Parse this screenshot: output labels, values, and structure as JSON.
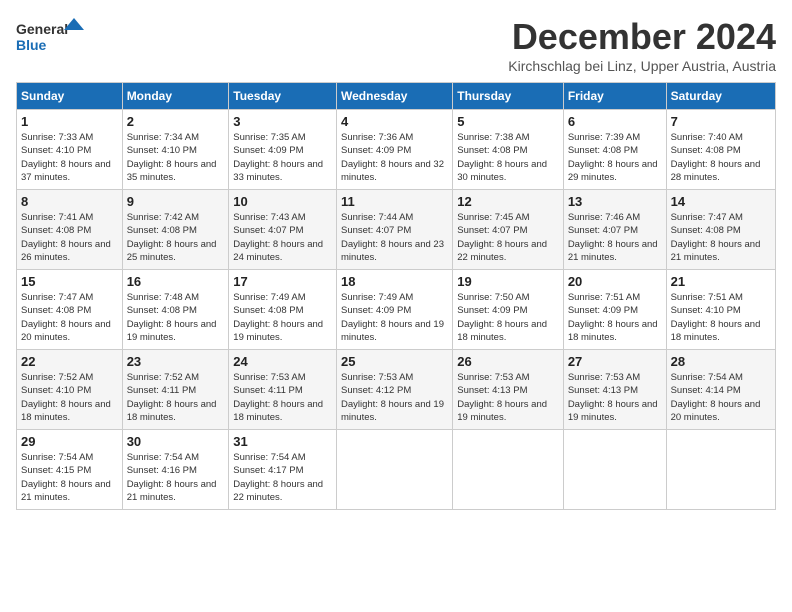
{
  "logo": {
    "line1": "General",
    "line2": "Blue"
  },
  "title": "December 2024",
  "subtitle": "Kirchschlag bei Linz, Upper Austria, Austria",
  "days_of_week": [
    "Sunday",
    "Monday",
    "Tuesday",
    "Wednesday",
    "Thursday",
    "Friday",
    "Saturday"
  ],
  "weeks": [
    [
      {
        "day": "1",
        "sunrise": "Sunrise: 7:33 AM",
        "sunset": "Sunset: 4:10 PM",
        "daylight": "Daylight: 8 hours and 37 minutes."
      },
      {
        "day": "2",
        "sunrise": "Sunrise: 7:34 AM",
        "sunset": "Sunset: 4:10 PM",
        "daylight": "Daylight: 8 hours and 35 minutes."
      },
      {
        "day": "3",
        "sunrise": "Sunrise: 7:35 AM",
        "sunset": "Sunset: 4:09 PM",
        "daylight": "Daylight: 8 hours and 33 minutes."
      },
      {
        "day": "4",
        "sunrise": "Sunrise: 7:36 AM",
        "sunset": "Sunset: 4:09 PM",
        "daylight": "Daylight: 8 hours and 32 minutes."
      },
      {
        "day": "5",
        "sunrise": "Sunrise: 7:38 AM",
        "sunset": "Sunset: 4:08 PM",
        "daylight": "Daylight: 8 hours and 30 minutes."
      },
      {
        "day": "6",
        "sunrise": "Sunrise: 7:39 AM",
        "sunset": "Sunset: 4:08 PM",
        "daylight": "Daylight: 8 hours and 29 minutes."
      },
      {
        "day": "7",
        "sunrise": "Sunrise: 7:40 AM",
        "sunset": "Sunset: 4:08 PM",
        "daylight": "Daylight: 8 hours and 28 minutes."
      }
    ],
    [
      {
        "day": "8",
        "sunrise": "Sunrise: 7:41 AM",
        "sunset": "Sunset: 4:08 PM",
        "daylight": "Daylight: 8 hours and 26 minutes."
      },
      {
        "day": "9",
        "sunrise": "Sunrise: 7:42 AM",
        "sunset": "Sunset: 4:08 PM",
        "daylight": "Daylight: 8 hours and 25 minutes."
      },
      {
        "day": "10",
        "sunrise": "Sunrise: 7:43 AM",
        "sunset": "Sunset: 4:07 PM",
        "daylight": "Daylight: 8 hours and 24 minutes."
      },
      {
        "day": "11",
        "sunrise": "Sunrise: 7:44 AM",
        "sunset": "Sunset: 4:07 PM",
        "daylight": "Daylight: 8 hours and 23 minutes."
      },
      {
        "day": "12",
        "sunrise": "Sunrise: 7:45 AM",
        "sunset": "Sunset: 4:07 PM",
        "daylight": "Daylight: 8 hours and 22 minutes."
      },
      {
        "day": "13",
        "sunrise": "Sunrise: 7:46 AM",
        "sunset": "Sunset: 4:07 PM",
        "daylight": "Daylight: 8 hours and 21 minutes."
      },
      {
        "day": "14",
        "sunrise": "Sunrise: 7:47 AM",
        "sunset": "Sunset: 4:08 PM",
        "daylight": "Daylight: 8 hours and 21 minutes."
      }
    ],
    [
      {
        "day": "15",
        "sunrise": "Sunrise: 7:47 AM",
        "sunset": "Sunset: 4:08 PM",
        "daylight": "Daylight: 8 hours and 20 minutes."
      },
      {
        "day": "16",
        "sunrise": "Sunrise: 7:48 AM",
        "sunset": "Sunset: 4:08 PM",
        "daylight": "Daylight: 8 hours and 19 minutes."
      },
      {
        "day": "17",
        "sunrise": "Sunrise: 7:49 AM",
        "sunset": "Sunset: 4:08 PM",
        "daylight": "Daylight: 8 hours and 19 minutes."
      },
      {
        "day": "18",
        "sunrise": "Sunrise: 7:49 AM",
        "sunset": "Sunset: 4:09 PM",
        "daylight": "Daylight: 8 hours and 19 minutes."
      },
      {
        "day": "19",
        "sunrise": "Sunrise: 7:50 AM",
        "sunset": "Sunset: 4:09 PM",
        "daylight": "Daylight: 8 hours and 18 minutes."
      },
      {
        "day": "20",
        "sunrise": "Sunrise: 7:51 AM",
        "sunset": "Sunset: 4:09 PM",
        "daylight": "Daylight: 8 hours and 18 minutes."
      },
      {
        "day": "21",
        "sunrise": "Sunrise: 7:51 AM",
        "sunset": "Sunset: 4:10 PM",
        "daylight": "Daylight: 8 hours and 18 minutes."
      }
    ],
    [
      {
        "day": "22",
        "sunrise": "Sunrise: 7:52 AM",
        "sunset": "Sunset: 4:10 PM",
        "daylight": "Daylight: 8 hours and 18 minutes."
      },
      {
        "day": "23",
        "sunrise": "Sunrise: 7:52 AM",
        "sunset": "Sunset: 4:11 PM",
        "daylight": "Daylight: 8 hours and 18 minutes."
      },
      {
        "day": "24",
        "sunrise": "Sunrise: 7:53 AM",
        "sunset": "Sunset: 4:11 PM",
        "daylight": "Daylight: 8 hours and 18 minutes."
      },
      {
        "day": "25",
        "sunrise": "Sunrise: 7:53 AM",
        "sunset": "Sunset: 4:12 PM",
        "daylight": "Daylight: 8 hours and 19 minutes."
      },
      {
        "day": "26",
        "sunrise": "Sunrise: 7:53 AM",
        "sunset": "Sunset: 4:13 PM",
        "daylight": "Daylight: 8 hours and 19 minutes."
      },
      {
        "day": "27",
        "sunrise": "Sunrise: 7:53 AM",
        "sunset": "Sunset: 4:13 PM",
        "daylight": "Daylight: 8 hours and 19 minutes."
      },
      {
        "day": "28",
        "sunrise": "Sunrise: 7:54 AM",
        "sunset": "Sunset: 4:14 PM",
        "daylight": "Daylight: 8 hours and 20 minutes."
      }
    ],
    [
      {
        "day": "29",
        "sunrise": "Sunrise: 7:54 AM",
        "sunset": "Sunset: 4:15 PM",
        "daylight": "Daylight: 8 hours and 21 minutes."
      },
      {
        "day": "30",
        "sunrise": "Sunrise: 7:54 AM",
        "sunset": "Sunset: 4:16 PM",
        "daylight": "Daylight: 8 hours and 21 minutes."
      },
      {
        "day": "31",
        "sunrise": "Sunrise: 7:54 AM",
        "sunset": "Sunset: 4:17 PM",
        "daylight": "Daylight: 8 hours and 22 minutes."
      },
      null,
      null,
      null,
      null
    ]
  ]
}
